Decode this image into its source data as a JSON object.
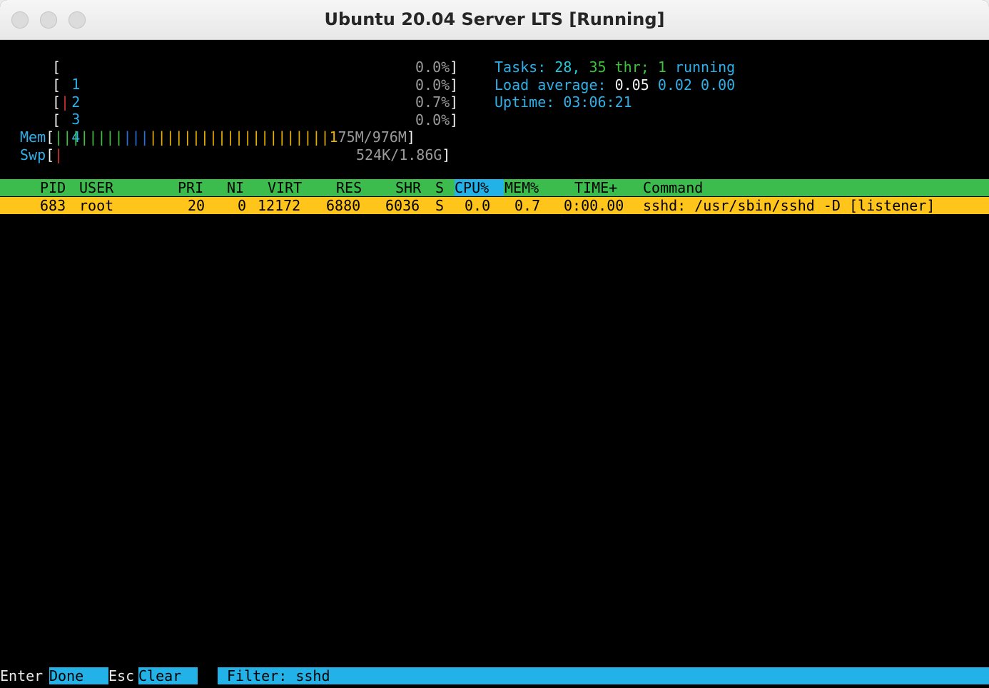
{
  "window": {
    "title": "Ubuntu 20.04 Server LTS [Running]"
  },
  "meters": {
    "cpus": [
      {
        "id": "1",
        "value": "0.0%",
        "bar": ""
      },
      {
        "id": "2",
        "value": "0.0%",
        "bar": ""
      },
      {
        "id": "3",
        "value": "0.7%",
        "bar": "|"
      },
      {
        "id": "4",
        "value": "0.0%",
        "bar": ""
      }
    ],
    "mem": {
      "label": "Mem",
      "bar_green": "||||||||",
      "bar_blue": "|||",
      "bar_yellow": "|||||||||||||||||||||1",
      "value": "75M/976M"
    },
    "swp": {
      "label": "Swp",
      "bar": "|",
      "value": "524K/1.86G"
    }
  },
  "summary": {
    "tasks_label": "Tasks:",
    "tasks": "28,",
    "threads": "35",
    "threads_label": "thr;",
    "running": "1",
    "running_label": "running",
    "load_label": "Load average:",
    "load1": "0.05",
    "load5": "0.02",
    "load15": "0.00",
    "uptime_label": "Uptime:",
    "uptime": "03:06:21"
  },
  "table": {
    "columns": {
      "pid": "PID",
      "user": "USER",
      "pri": "PRI",
      "ni": "NI",
      "virt": "VIRT",
      "res": "RES",
      "shr": "SHR",
      "s": "S",
      "cpu": "CPU%",
      "mem": "MEM%",
      "time": "TIME+",
      "command": "Command"
    },
    "rows": [
      {
        "pid": "683",
        "user": "root",
        "pri": "20",
        "ni": "0",
        "virt": "12172",
        "res": "6880",
        "shr": "6036",
        "s": "S",
        "cpu": "0.0",
        "mem": "0.7",
        "time": "0:00.00",
        "command": "sshd: /usr/sbin/sshd -D [listener]"
      }
    ]
  },
  "footer": {
    "enter_key": "Enter",
    "enter_action": "Done  ",
    "esc_key": "Esc",
    "esc_action": "Clear  ",
    "filter_label": "Filter:",
    "filter_value": "sshd"
  },
  "colors": {
    "header_bg": "#3cbc4c",
    "selected_bg": "#ffc51a",
    "accent_cyan": "#23b2e8"
  }
}
